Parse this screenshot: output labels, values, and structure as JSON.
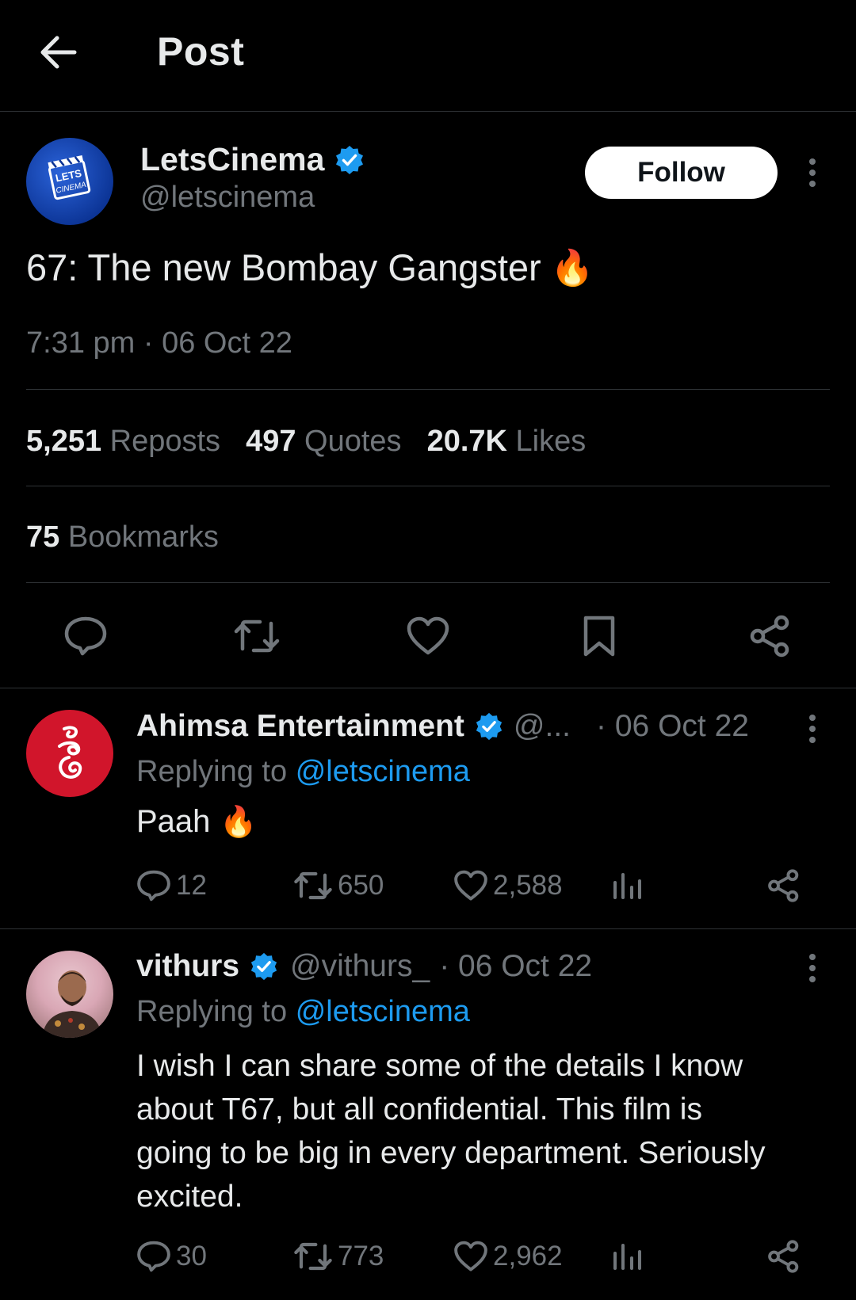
{
  "header": {
    "title": "Post",
    "back_icon": "arrow-left-icon"
  },
  "post": {
    "author_name": "LetsCinema",
    "handle": "@letscinema",
    "avatar_text": "LETS CINEMA",
    "follow_label": "Follow",
    "text": "67: The new Bombay Gangster",
    "emoji": "🔥",
    "timestamp": "7:31 pm · 06 Oct 22",
    "stats": {
      "reposts_num": "5,251",
      "reposts_label": "Reposts",
      "quotes_num": "497",
      "quotes_label": "Quotes",
      "likes_num": "20.7K",
      "likes_label": "Likes",
      "bookmarks_num": "75",
      "bookmarks_label": "Bookmarks"
    }
  },
  "replies": [
    {
      "name": "Ahimsa Entertainment",
      "handle": "@...",
      "date": "· 06 Oct 22",
      "replying_prefix": "Replying to",
      "replying_to": "@letscinema",
      "text": "Paah",
      "emoji": "🔥",
      "replies": "12",
      "reposts": "650",
      "likes": "2,588"
    },
    {
      "name": "vithurs",
      "handle": "@vithurs_",
      "date": "· 06 Oct 22",
      "replying_prefix": "Replying to",
      "replying_to": "@letscinema",
      "text_lines": [
        "I wish I can share some of the details I know",
        "about T67, but all confidential. This film is",
        "going to be big in every department. Seriously",
        "excited."
      ],
      "replies": "30",
      "reposts": "773",
      "likes": "2,962"
    }
  ],
  "colors": {
    "accent": "#1d9bf0",
    "secondary_text": "#71767b",
    "divider": "#2f3336",
    "ahimsa_red": "#d1152b"
  }
}
